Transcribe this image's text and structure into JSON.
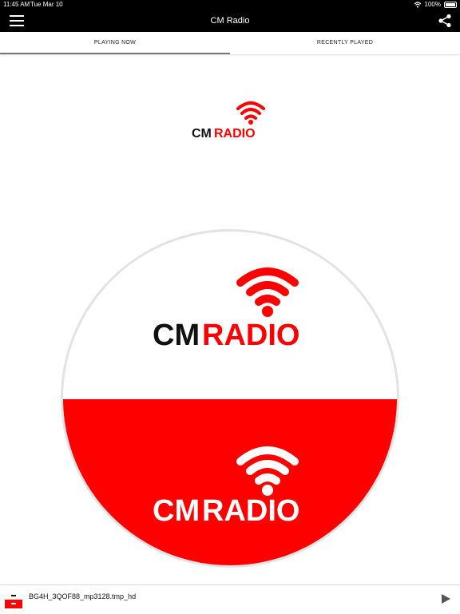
{
  "status": {
    "time": "11:45 AM",
    "date": "Tue Mar 10",
    "battery": "100%"
  },
  "nav": {
    "title": "CM Radio"
  },
  "tabs": [
    {
      "label": "PLAYING NOW",
      "active": true
    },
    {
      "label": "RECENTLY PLAYED",
      "active": false
    }
  ],
  "logo": {
    "word1": "CM",
    "word2": "RADIO",
    "brand_red": "#ff0000",
    "brand_black": "#111111"
  },
  "player": {
    "track": "BG4H_3QOF88_mp3128.tmp_hd"
  },
  "icons": {
    "menu": "hamburger-icon",
    "share": "share-icon",
    "play": "play-icon",
    "wifi": "wifi-icon"
  }
}
